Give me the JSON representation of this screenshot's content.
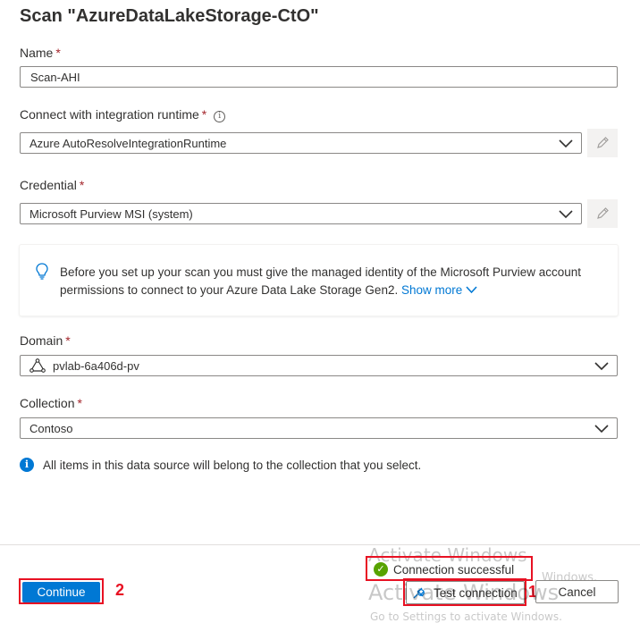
{
  "title": "Scan \"AzureDataLakeStorage-CtO\"",
  "required_marker": "*",
  "name": {
    "label": "Name",
    "value": "Scan-AHI"
  },
  "runtime": {
    "label": "Connect with integration runtime",
    "value": "Azure AutoResolveIntegrationRuntime",
    "info_icon": "i"
  },
  "credential": {
    "label": "Credential",
    "value": "Microsoft Purview MSI (system)"
  },
  "info_box": {
    "text": "Before you set up your scan you must give the managed identity of the Microsoft Purview account permissions to connect to your Azure Data Lake Storage Gen2.",
    "link": "Show more"
  },
  "domain": {
    "label": "Domain",
    "value": "pvlab-6a406d-pv"
  },
  "collection": {
    "label": "Collection",
    "value": "Contoso"
  },
  "note": {
    "icon": "i",
    "text": "All items in this data source will belong to the collection that you select."
  },
  "footer": {
    "continue_label": "Continue",
    "test_label": "Test connection",
    "cancel_label": "Cancel",
    "connection_status": "Connection successful",
    "status_check": "✓"
  },
  "annotations": {
    "marker_1": "1",
    "marker_2": "2"
  },
  "watermark": {
    "line1": "Activate Windows",
    "line2": "Windows.",
    "line3": "Go to Settings to activate Windows."
  },
  "colors": {
    "accent": "#0078d4",
    "required": "#a4262c",
    "annotation": "#e81123",
    "success": "#57a300"
  }
}
